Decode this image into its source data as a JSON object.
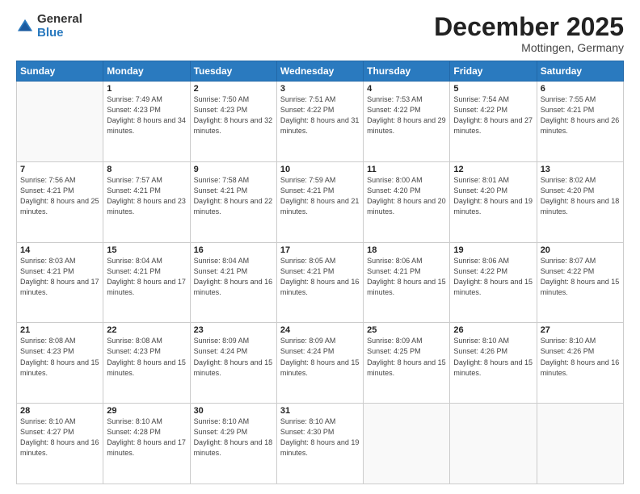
{
  "logo": {
    "general": "General",
    "blue": "Blue"
  },
  "header": {
    "month": "December 2025",
    "location": "Mottingen, Germany"
  },
  "days_header": [
    "Sunday",
    "Monday",
    "Tuesday",
    "Wednesday",
    "Thursday",
    "Friday",
    "Saturday"
  ],
  "weeks": [
    [
      {
        "day": "",
        "info": ""
      },
      {
        "day": "1",
        "info": "Sunrise: 7:49 AM\nSunset: 4:23 PM\nDaylight: 8 hours\nand 34 minutes."
      },
      {
        "day": "2",
        "info": "Sunrise: 7:50 AM\nSunset: 4:23 PM\nDaylight: 8 hours\nand 32 minutes."
      },
      {
        "day": "3",
        "info": "Sunrise: 7:51 AM\nSunset: 4:22 PM\nDaylight: 8 hours\nand 31 minutes."
      },
      {
        "day": "4",
        "info": "Sunrise: 7:53 AM\nSunset: 4:22 PM\nDaylight: 8 hours\nand 29 minutes."
      },
      {
        "day": "5",
        "info": "Sunrise: 7:54 AM\nSunset: 4:22 PM\nDaylight: 8 hours\nand 27 minutes."
      },
      {
        "day": "6",
        "info": "Sunrise: 7:55 AM\nSunset: 4:21 PM\nDaylight: 8 hours\nand 26 minutes."
      }
    ],
    [
      {
        "day": "7",
        "info": "Sunrise: 7:56 AM\nSunset: 4:21 PM\nDaylight: 8 hours\nand 25 minutes."
      },
      {
        "day": "8",
        "info": "Sunrise: 7:57 AM\nSunset: 4:21 PM\nDaylight: 8 hours\nand 23 minutes."
      },
      {
        "day": "9",
        "info": "Sunrise: 7:58 AM\nSunset: 4:21 PM\nDaylight: 8 hours\nand 22 minutes."
      },
      {
        "day": "10",
        "info": "Sunrise: 7:59 AM\nSunset: 4:21 PM\nDaylight: 8 hours\nand 21 minutes."
      },
      {
        "day": "11",
        "info": "Sunrise: 8:00 AM\nSunset: 4:20 PM\nDaylight: 8 hours\nand 20 minutes."
      },
      {
        "day": "12",
        "info": "Sunrise: 8:01 AM\nSunset: 4:20 PM\nDaylight: 8 hours\nand 19 minutes."
      },
      {
        "day": "13",
        "info": "Sunrise: 8:02 AM\nSunset: 4:20 PM\nDaylight: 8 hours\nand 18 minutes."
      }
    ],
    [
      {
        "day": "14",
        "info": "Sunrise: 8:03 AM\nSunset: 4:21 PM\nDaylight: 8 hours\nand 17 minutes."
      },
      {
        "day": "15",
        "info": "Sunrise: 8:04 AM\nSunset: 4:21 PM\nDaylight: 8 hours\nand 17 minutes."
      },
      {
        "day": "16",
        "info": "Sunrise: 8:04 AM\nSunset: 4:21 PM\nDaylight: 8 hours\nand 16 minutes."
      },
      {
        "day": "17",
        "info": "Sunrise: 8:05 AM\nSunset: 4:21 PM\nDaylight: 8 hours\nand 16 minutes."
      },
      {
        "day": "18",
        "info": "Sunrise: 8:06 AM\nSunset: 4:21 PM\nDaylight: 8 hours\nand 15 minutes."
      },
      {
        "day": "19",
        "info": "Sunrise: 8:06 AM\nSunset: 4:22 PM\nDaylight: 8 hours\nand 15 minutes."
      },
      {
        "day": "20",
        "info": "Sunrise: 8:07 AM\nSunset: 4:22 PM\nDaylight: 8 hours\nand 15 minutes."
      }
    ],
    [
      {
        "day": "21",
        "info": "Sunrise: 8:08 AM\nSunset: 4:23 PM\nDaylight: 8 hours\nand 15 minutes."
      },
      {
        "day": "22",
        "info": "Sunrise: 8:08 AM\nSunset: 4:23 PM\nDaylight: 8 hours\nand 15 minutes."
      },
      {
        "day": "23",
        "info": "Sunrise: 8:09 AM\nSunset: 4:24 PM\nDaylight: 8 hours\nand 15 minutes."
      },
      {
        "day": "24",
        "info": "Sunrise: 8:09 AM\nSunset: 4:24 PM\nDaylight: 8 hours\nand 15 minutes."
      },
      {
        "day": "25",
        "info": "Sunrise: 8:09 AM\nSunset: 4:25 PM\nDaylight: 8 hours\nand 15 minutes."
      },
      {
        "day": "26",
        "info": "Sunrise: 8:10 AM\nSunset: 4:26 PM\nDaylight: 8 hours\nand 15 minutes."
      },
      {
        "day": "27",
        "info": "Sunrise: 8:10 AM\nSunset: 4:26 PM\nDaylight: 8 hours\nand 16 minutes."
      }
    ],
    [
      {
        "day": "28",
        "info": "Sunrise: 8:10 AM\nSunset: 4:27 PM\nDaylight: 8 hours\nand 16 minutes."
      },
      {
        "day": "29",
        "info": "Sunrise: 8:10 AM\nSunset: 4:28 PM\nDaylight: 8 hours\nand 17 minutes."
      },
      {
        "day": "30",
        "info": "Sunrise: 8:10 AM\nSunset: 4:29 PM\nDaylight: 8 hours\nand 18 minutes."
      },
      {
        "day": "31",
        "info": "Sunrise: 8:10 AM\nSunset: 4:30 PM\nDaylight: 8 hours\nand 19 minutes."
      },
      {
        "day": "",
        "info": ""
      },
      {
        "day": "",
        "info": ""
      },
      {
        "day": "",
        "info": ""
      }
    ]
  ]
}
